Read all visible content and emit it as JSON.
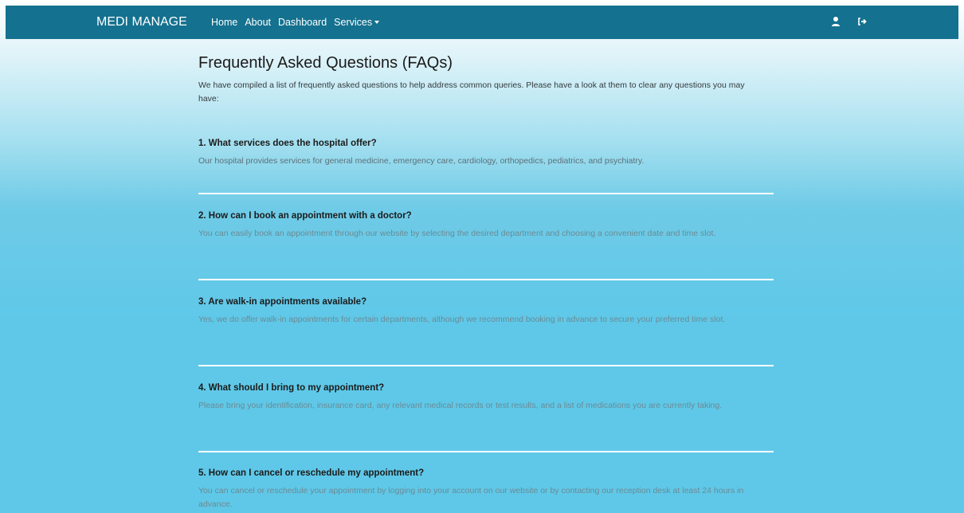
{
  "navbar": {
    "brand": "MEDI MANAGE",
    "links": [
      {
        "label": "Home"
      },
      {
        "label": "About"
      },
      {
        "label": "Dashboard"
      },
      {
        "label": "Services"
      }
    ],
    "icons": [
      "user-icon",
      "logout-icon"
    ],
    "background": "#14718f"
  },
  "page": {
    "title": "Frequently Asked Questions (FAQs)",
    "intro": "We have compiled a list of frequently asked questions to help address common queries. Please have a look at them to clear any questions you may have:"
  },
  "faqs": [
    {
      "question": "1. What services does the hospital offer?",
      "answer": "Our hospital provides services for general medicine, emergency care, cardiology, orthopedics, pediatrics, and psychiatry."
    },
    {
      "question": "2. How can I book an appointment with a doctor?",
      "answer": "You can easily book an appointment through our website by selecting the desired department and choosing a convenient date and time slot."
    },
    {
      "question": "3. Are walk-in appointments available?",
      "answer": "Yes, we do offer walk-in appointments for certain departments, although we recommend booking in advance to secure your preferred time slot."
    },
    {
      "question": "4. What should I bring to my appointment?",
      "answer": "Please bring your identification, insurance card, any relevant medical records or test results, and a list of medications you are currently taking."
    },
    {
      "question": "5. How can I cancel or reschedule my appointment?",
      "answer": "You can cancel or reschedule your appointment by logging into your account on our website or by contacting our reception desk at least 24 hours in advance."
    }
  ]
}
